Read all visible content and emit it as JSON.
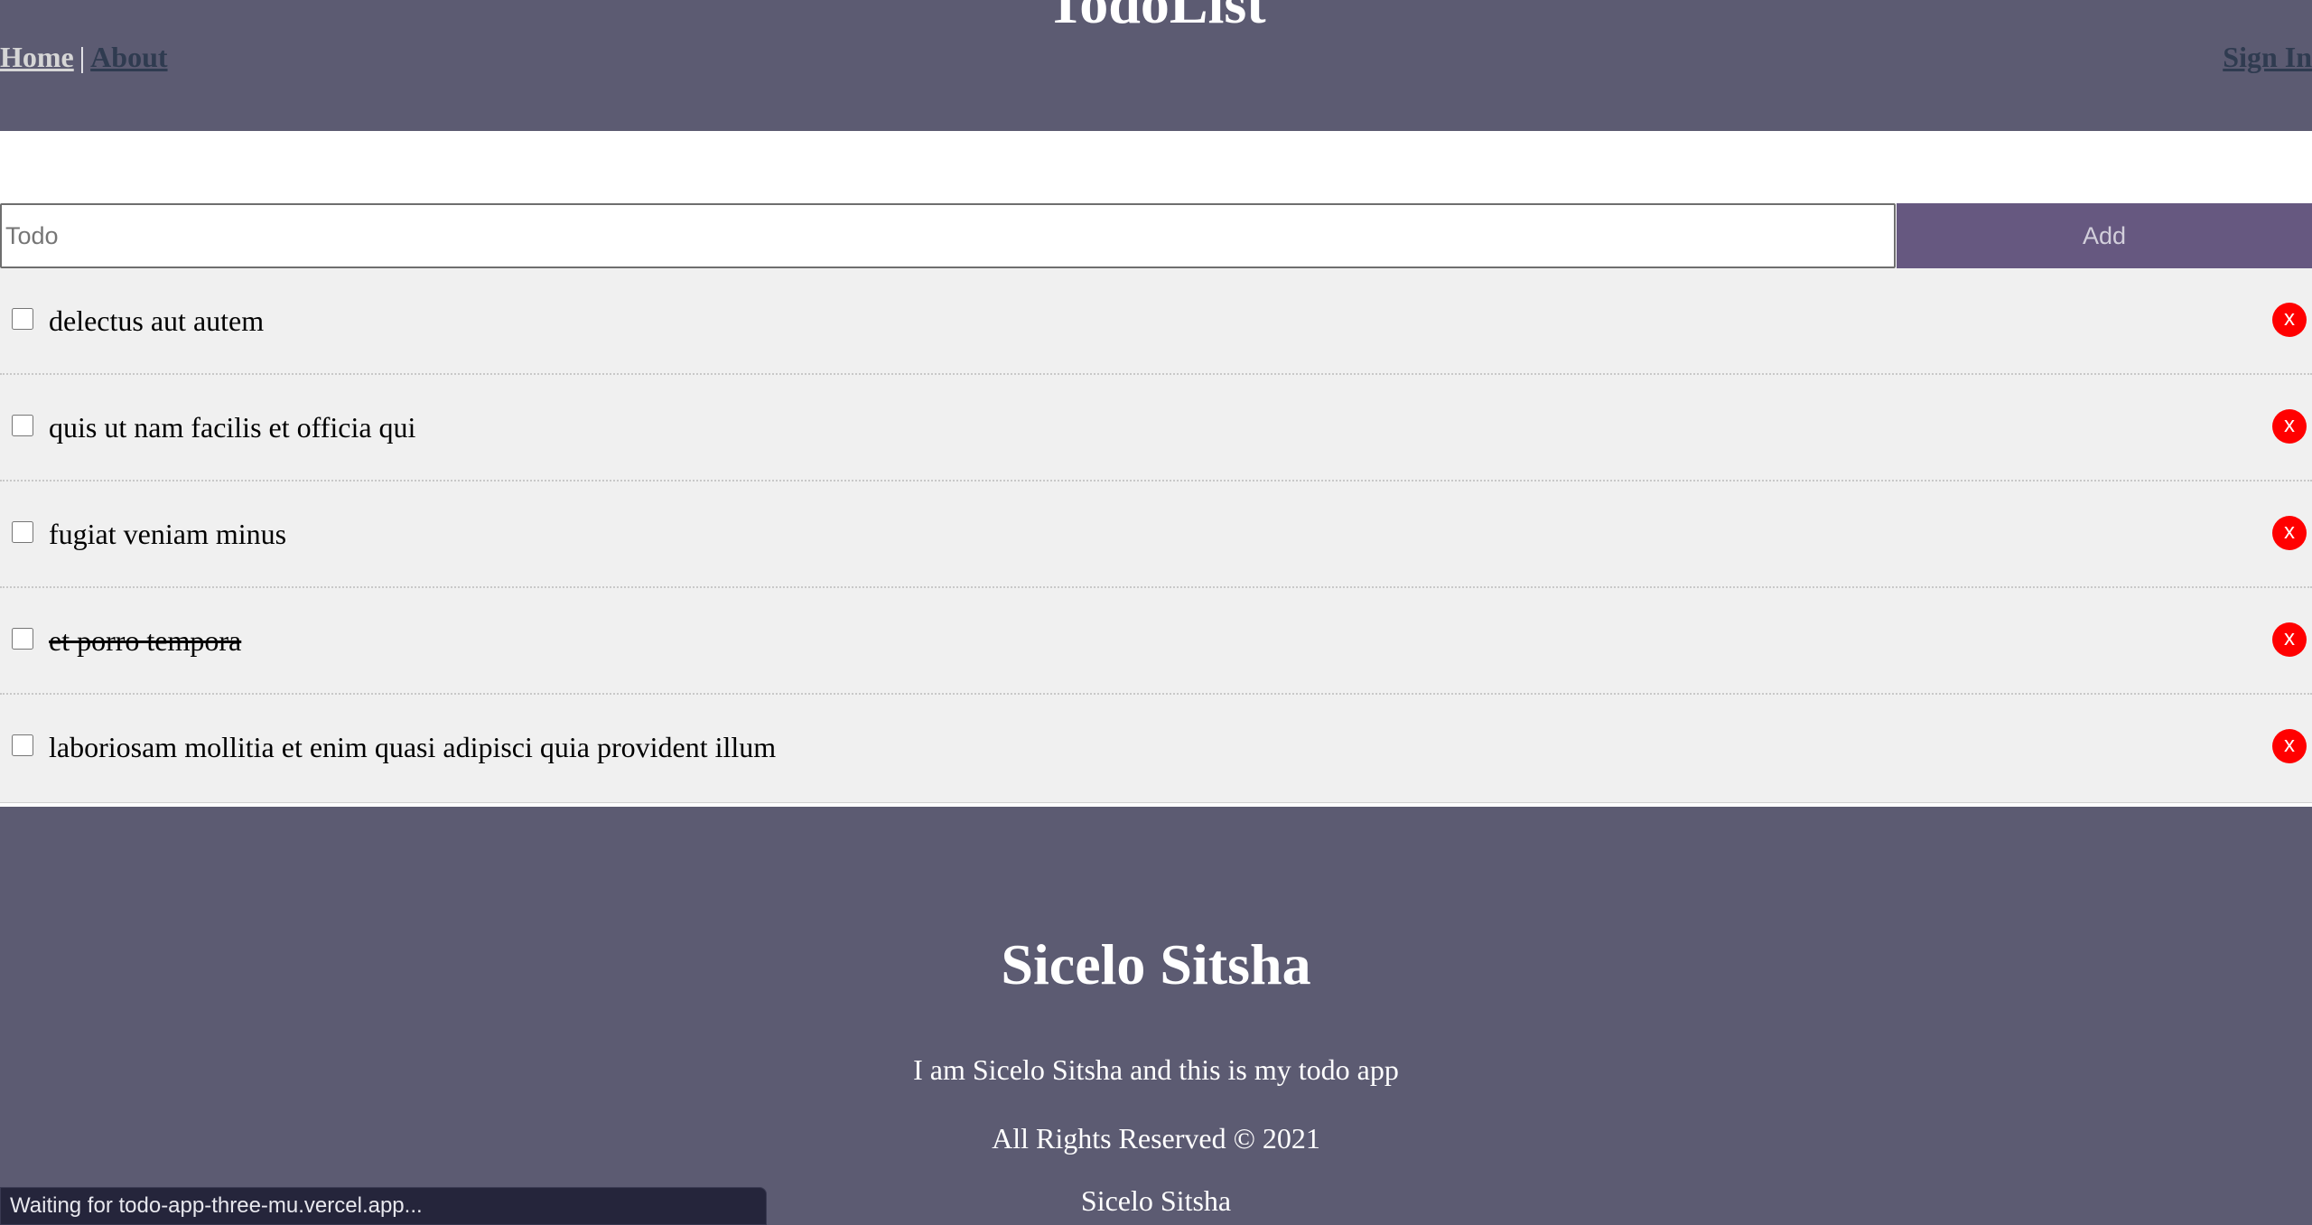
{
  "header": {
    "title": "TodoList",
    "nav": {
      "home": "Home",
      "separator": "|",
      "about": "About",
      "sign_in": "Sign In"
    }
  },
  "add_form": {
    "placeholder": "Todo",
    "value": "",
    "add_label": "Add"
  },
  "todos": [
    {
      "text": "delectus aut autem",
      "completed": false,
      "delete_label": "x"
    },
    {
      "text": "quis ut nam facilis et officia qui",
      "completed": false,
      "delete_label": "x"
    },
    {
      "text": "fugiat veniam minus",
      "completed": false,
      "delete_label": "x"
    },
    {
      "text": "et porro tempora",
      "completed": true,
      "delete_label": "x"
    },
    {
      "text": "laboriosam mollitia et enim quasi adipisci quia provident illum",
      "completed": false,
      "delete_label": "x"
    }
  ],
  "footer": {
    "name": "Sicelo Sitsha",
    "description": "I am Sicelo Sitsha and this is my todo app",
    "rights": "All Rights Reserved © 2021",
    "author": "Sicelo Sitsha"
  },
  "status_bar": {
    "text": "Waiting for todo-app-three-mu.vercel.app..."
  },
  "colors": {
    "header_bg": "#5c5b72",
    "add_button_bg": "#665880",
    "delete_button_bg": "#ff0000",
    "item_bg": "#f0f0f0"
  }
}
